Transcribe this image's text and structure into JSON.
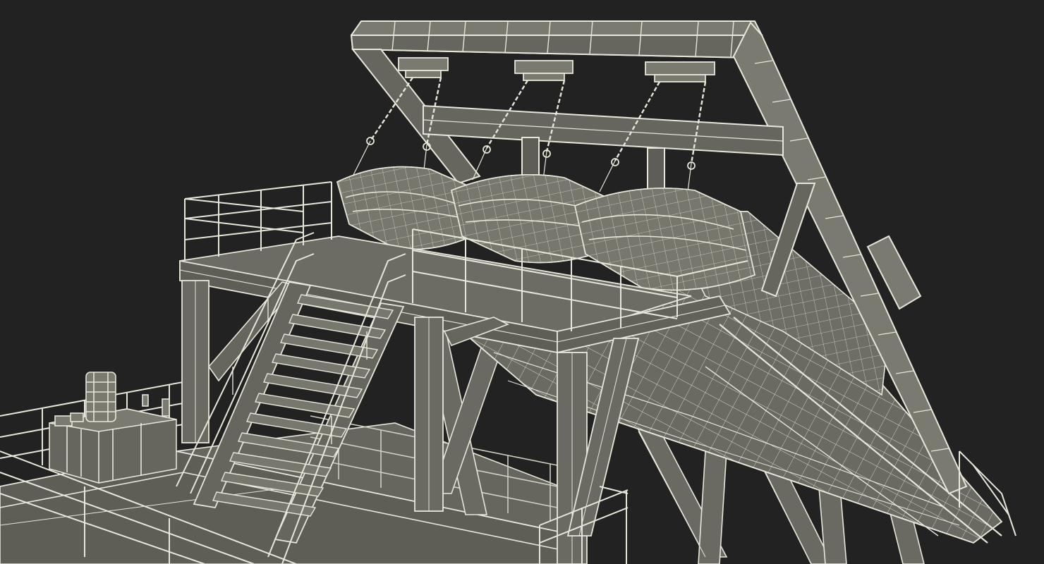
{
  "scene": {
    "subject": "wireframe-render-of-lifeboat-davit-platform",
    "colors": {
      "background": "#222222",
      "fill": "#6f6f66",
      "fill_dark": "#575750",
      "fill_light": "#8a8a80",
      "wire": "#e6e6da",
      "wire_dim": "#b9b9ad"
    },
    "lifeboat_count": 3,
    "davit_hook_count": 3
  }
}
